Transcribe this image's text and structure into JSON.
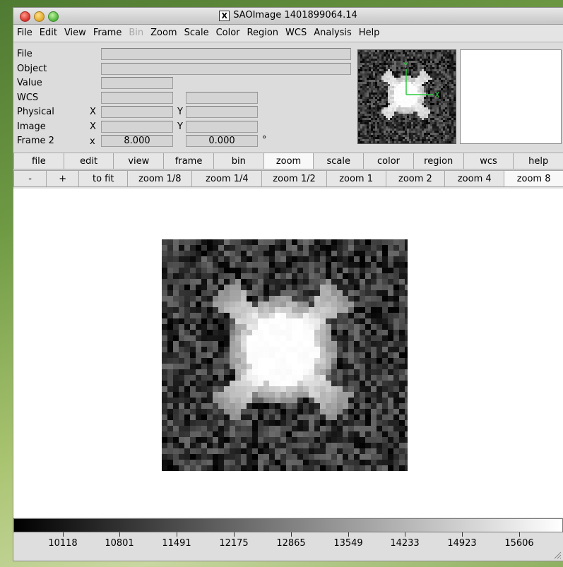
{
  "window": {
    "title": "SAOImage 1401899064.14"
  },
  "menubar": [
    "File",
    "Edit",
    "View",
    "Frame",
    "Bin",
    "Zoom",
    "Scale",
    "Color",
    "Region",
    "WCS",
    "Analysis",
    "Help"
  ],
  "menubar_disabled": [
    "Bin"
  ],
  "info_panel": {
    "labels": {
      "file": "File",
      "object": "Object",
      "value": "Value",
      "wcs": "WCS",
      "physical": "Physical",
      "image": "Image",
      "frame": "Frame 2"
    },
    "axis_x": "X",
    "axis_y": "Y",
    "frame_axis": "x",
    "zoom_value": "8.000",
    "angle_value": "0.000",
    "angle_unit": "°"
  },
  "panner": {
    "axis_x_label": "X",
    "axis_y_label": "Y",
    "compass_color": "#2ecc40"
  },
  "button_bar": [
    "file",
    "edit",
    "view",
    "frame",
    "bin",
    "zoom",
    "scale",
    "color",
    "region",
    "wcs",
    "help"
  ],
  "button_bar_active": "zoom",
  "zoom_bar": [
    "-",
    "+",
    "to fit",
    "zoom 1/8",
    "zoom 1/4",
    "zoom 1/2",
    "zoom 1",
    "zoom 2",
    "zoom 4",
    "zoom 8"
  ],
  "zoom_bar_active": "zoom 8",
  "colorbar": {
    "ticks": [
      "10118",
      "10801",
      "11491",
      "12175",
      "12865",
      "13549",
      "14233",
      "14923",
      "15606"
    ],
    "tick_fractions": [
      0.09,
      0.193,
      0.297,
      0.401,
      0.505,
      0.609,
      0.712,
      0.816,
      0.92
    ]
  }
}
